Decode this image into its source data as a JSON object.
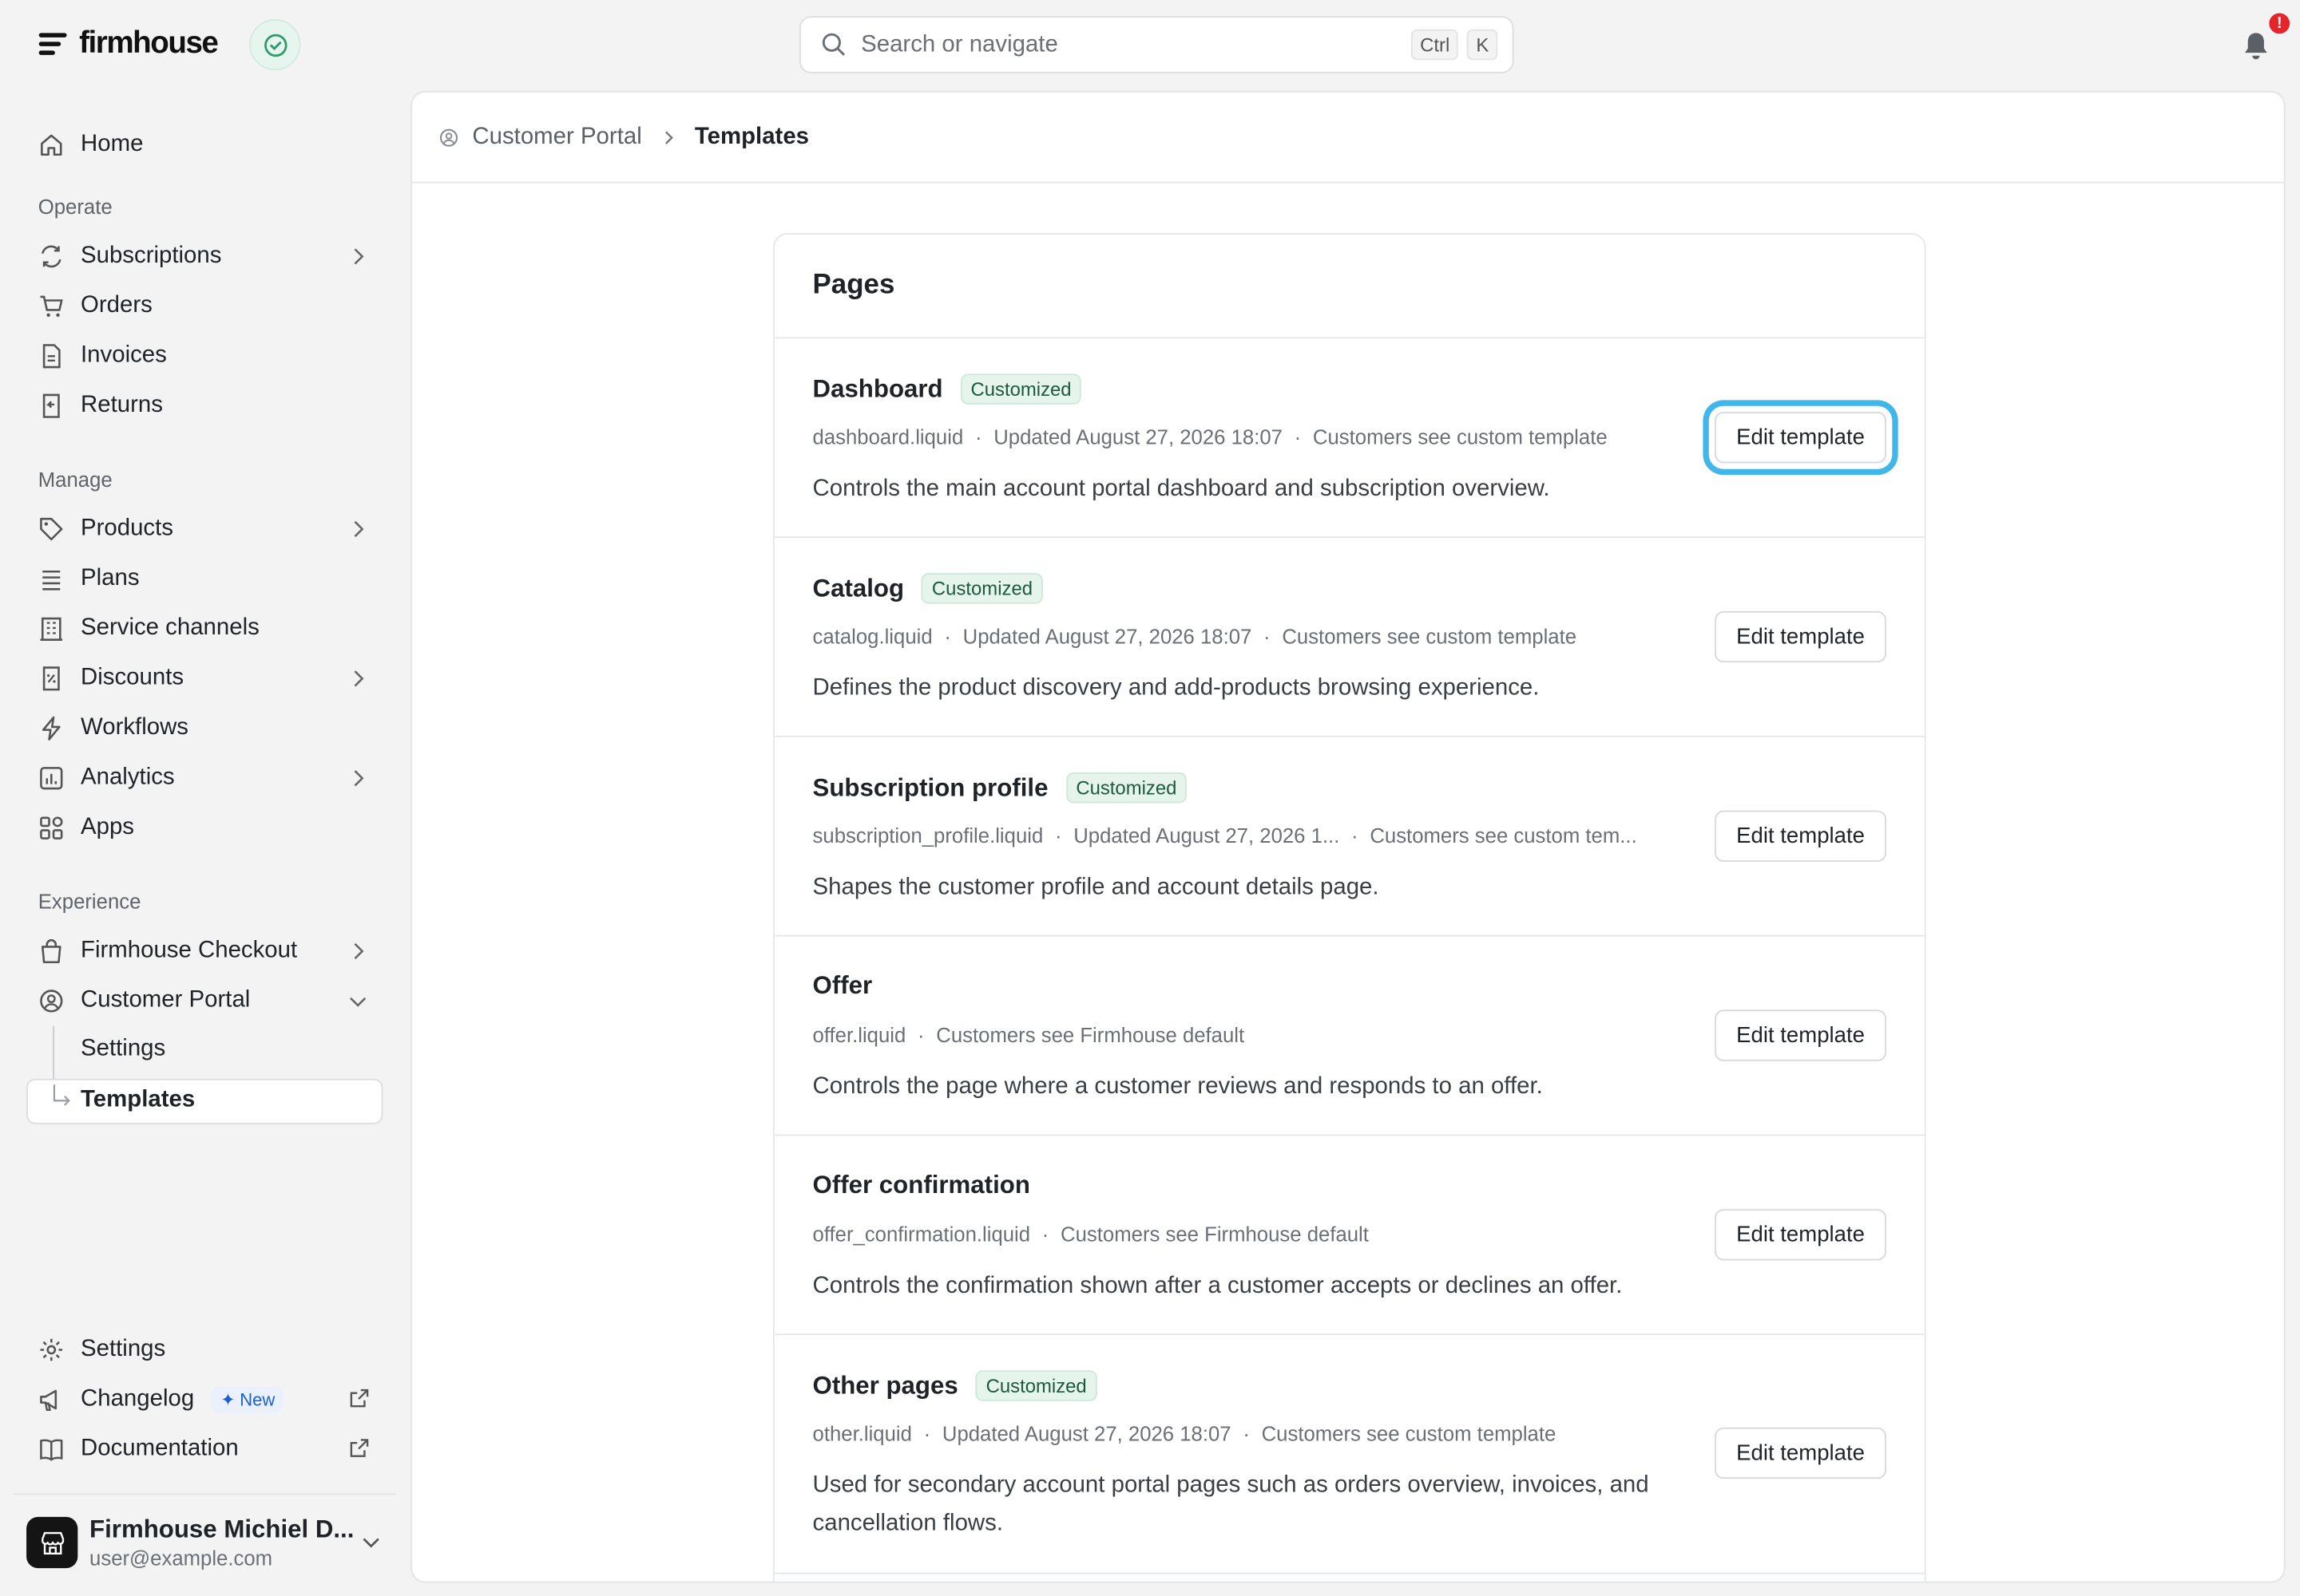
{
  "app": {
    "logo_text": "firmhouse"
  },
  "search": {
    "placeholder": "Search or navigate",
    "kbd_ctrl": "Ctrl",
    "kbd_k": "K"
  },
  "notifications": {
    "badge": "!"
  },
  "sidebar": {
    "home": "Home",
    "section_operate": "Operate",
    "subscriptions": "Subscriptions",
    "orders": "Orders",
    "invoices": "Invoices",
    "returns": "Returns",
    "section_manage": "Manage",
    "products": "Products",
    "plans": "Plans",
    "service_channels": "Service channels",
    "discounts": "Discounts",
    "workflows": "Workflows",
    "analytics": "Analytics",
    "apps": "Apps",
    "section_experience": "Experience",
    "firmhouse_checkout": "Firmhouse Checkout",
    "customer_portal": "Customer Portal",
    "cp_settings": "Settings",
    "cp_templates": "Templates",
    "settings": "Settings",
    "changelog": "Changelog",
    "changelog_badge": "New",
    "documentation": "Documentation"
  },
  "account": {
    "name": "Firmhouse Michiel D...",
    "email": "user@example.com"
  },
  "breadcrumb": {
    "parent": "Customer Portal",
    "current": "Templates"
  },
  "pages": {
    "title": "Pages",
    "edit_label": "Edit template",
    "rows": [
      {
        "name": "Dashboard",
        "tag": "Customized",
        "file": "dashboard.liquid",
        "updated": "Updated August 27, 2026 18:07",
        "visibility": "Customers see custom template",
        "description": "Controls the main account portal dashboard and subscription overview."
      },
      {
        "name": "Catalog",
        "tag": "Customized",
        "file": "catalog.liquid",
        "updated": "Updated August 27, 2026 18:07",
        "visibility": "Customers see custom template",
        "description": "Defines the product discovery and add-products browsing experience."
      },
      {
        "name": "Subscription profile",
        "tag": "Customized",
        "file": "subscription_profile.liquid",
        "updated": "Updated August 27, 2026 1...",
        "visibility": "Customers see custom tem...",
        "description": "Shapes the customer profile and account details page."
      },
      {
        "name": "Offer",
        "tag": "",
        "file": "offer.liquid",
        "updated": "",
        "visibility": "Customers see Firmhouse default",
        "description": "Controls the page where a customer reviews and responds to an offer."
      },
      {
        "name": "Offer confirmation",
        "tag": "",
        "file": "offer_confirmation.liquid",
        "updated": "",
        "visibility": "Customers see Firmhouse default",
        "description": "Controls the confirmation shown after a customer accepts or declines an offer."
      },
      {
        "name": "Other pages",
        "tag": "Customized",
        "file": "other.liquid",
        "updated": "Updated August 27, 2026 18:07",
        "visibility": "Customers see custom template",
        "description": "Used for secondary account portal pages such as orders overview, invoices, and cancellation flows."
      }
    ]
  }
}
